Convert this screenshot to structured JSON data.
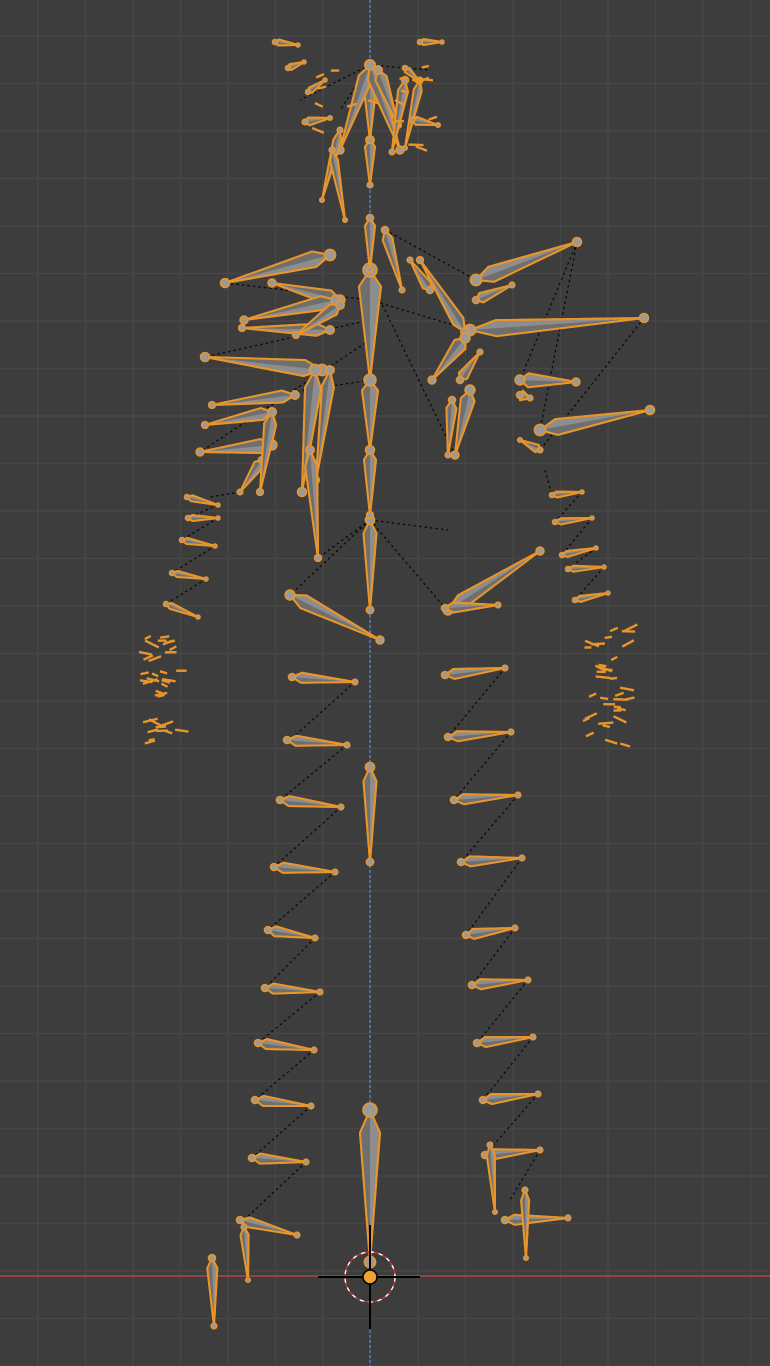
{
  "viewport": {
    "background_color": "#3d3d3d",
    "grid_minor_color": "#474747",
    "grid_major_color": "#505050",
    "x_axis_color": "#b0454f",
    "z_axis_color": "#4f7dc8",
    "bone_outline_color": "#e8952c",
    "bone_fill_color": "#8d8d8d",
    "selected": true
  },
  "armature": {
    "object_type": "armature",
    "display_mode": "octahedral",
    "icons": [
      "3d-cursor-icon",
      "object-origin-icon"
    ]
  }
}
